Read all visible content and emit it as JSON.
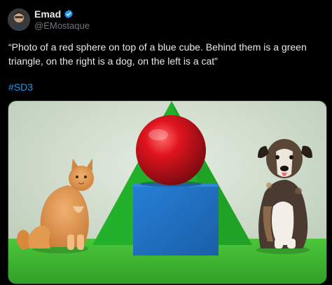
{
  "author": {
    "name": "Emad",
    "handle": "@EMostaque",
    "avatar_icon": "profile-avatar",
    "verified_icon": "verified-badge-icon",
    "verified_color": "#1d9bf0"
  },
  "tweet": {
    "text": "“Photo of a red sphere on top of a blue cube. Behind them is a green triangle, on the right is a dog, on the left is a cat”",
    "hashtag": "#SD3"
  },
  "colors": {
    "background": "#000000",
    "text": "#e7e9ea",
    "secondary_text": "#71767b",
    "link": "#1d9bf0",
    "triangle": "#23b02a",
    "floor": "#3fbf33",
    "sphere": "#d0121c",
    "cube": "#1f6fc0",
    "wall": "#d3e0d0"
  }
}
